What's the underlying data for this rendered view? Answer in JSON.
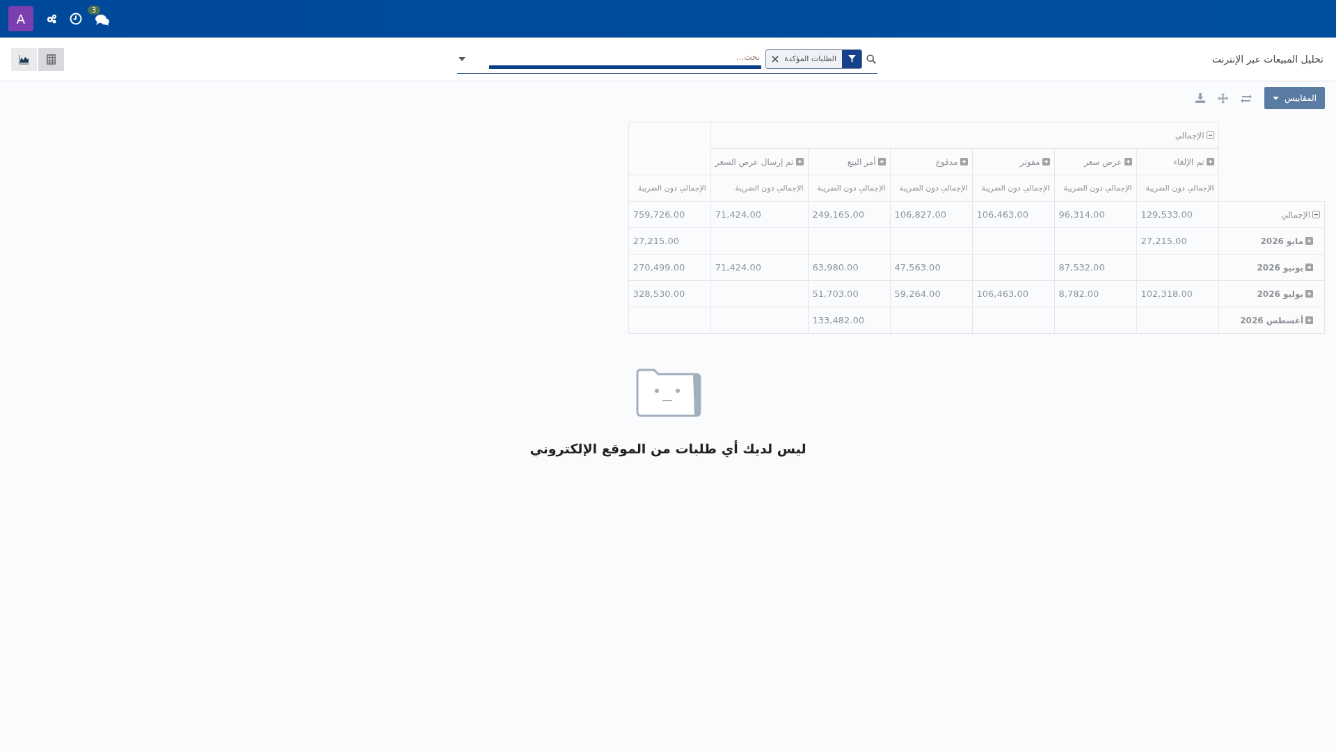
{
  "navbar": {
    "avatar": "A",
    "messages_badge": "3"
  },
  "breadcrumb": "تحليل المبيعات عبر الإنترنت",
  "search": {
    "facets": [
      {
        "label": "الطلبات المؤكدة"
      }
    ],
    "placeholder": "بحث..."
  },
  "views": [
    {
      "kind": "graph",
      "selected": false
    },
    {
      "kind": "pivot",
      "selected": true
    }
  ],
  "measures_button": "المقاييس",
  "pivot": {
    "column_total": {
      "label": "الإجمالي",
      "expanded": true
    },
    "groups": [
      {
        "label": "تم الإلغاء",
        "expanded": false
      },
      {
        "label": "عرض سعر",
        "expanded": false
      },
      {
        "label": "مفوتر",
        "expanded": false
      },
      {
        "label": "مدفوع",
        "expanded": false
      },
      {
        "label": "أمر البيع",
        "expanded": false
      },
      {
        "label": "تم إرسال عرض السعر",
        "expanded": false
      }
    ],
    "measure_headers": [
      "الإجمالي دون الضريبة",
      "الإجمالي دون الضريبة",
      "الإجمالي دون الضريبة",
      "الإجمالي دون الضريبة",
      "الإجمالي دون الضريبة",
      "الإجمالي دون الضريبة",
      "الإجمالي دون الضريبة"
    ],
    "rows": [
      {
        "label": "الإجمالي",
        "expanded": true,
        "cells": [
          {
            "kind": "amount",
            "value": "129,533.00"
          },
          {
            "kind": "amount",
            "value": "96,314.00"
          },
          {
            "kind": "amount",
            "value": "106,463.00"
          },
          {
            "kind": "amount",
            "value": "106,827.00"
          },
          {
            "kind": "amount",
            "value": "249,165.00"
          },
          {
            "kind": "amount",
            "value": "71,424.00"
          },
          {
            "kind": "amount",
            "value": "759,726.00"
          }
        ]
      },
      {
        "label": "مايو 2026",
        "expanded": false,
        "cells": [
          {
            "kind": "amount",
            "value": "27,215.00"
          },
          {
            "kind": "empty"
          },
          {
            "kind": "empty"
          },
          {
            "kind": "empty"
          },
          {
            "kind": "empty"
          },
          {
            "kind": "empty"
          },
          {
            "kind": "amount",
            "value": "27,215.00"
          }
        ]
      },
      {
        "label": "يونيو 2026",
        "expanded": false,
        "cells": [
          {
            "kind": "empty"
          },
          {
            "kind": "amount",
            "value": "87,532.00"
          },
          {
            "kind": "empty"
          },
          {
            "kind": "amount",
            "value": "47,563.00"
          },
          {
            "kind": "amount",
            "value": "63,980.00"
          },
          {
            "kind": "amount",
            "value": "71,424.00"
          },
          {
            "kind": "amount",
            "value": "270,499.00"
          }
        ]
      },
      {
        "label": "يوليو 2026",
        "expanded": false,
        "cells": [
          {
            "kind": "amount",
            "value": "102,318.00"
          },
          {
            "kind": "amount",
            "value": "8,782.00"
          },
          {
            "kind": "amount",
            "value": "106,463.00"
          },
          {
            "kind": "amount",
            "value": "59,264.00"
          },
          {
            "kind": "amount",
            "value": "51,703.00"
          },
          {
            "kind": "empty"
          },
          {
            "kind": "amount",
            "value": "328,530.00"
          }
        ]
      },
      {
        "label": "أغسطس 2026",
        "expanded": false,
        "cells": [
          {
            "kind": "empty"
          },
          {
            "kind": "empty"
          },
          {
            "kind": "empty"
          },
          {
            "kind": "empty"
          },
          {
            "kind": "amount",
            "value": "133,482.00"
          },
          {
            "kind": "empty"
          },
          {
            "kind": "empty"
          }
        ]
      }
    ]
  },
  "empty_state": {
    "title": "ليس لديك أي طلبات من الموقع الإلكتروني"
  }
}
